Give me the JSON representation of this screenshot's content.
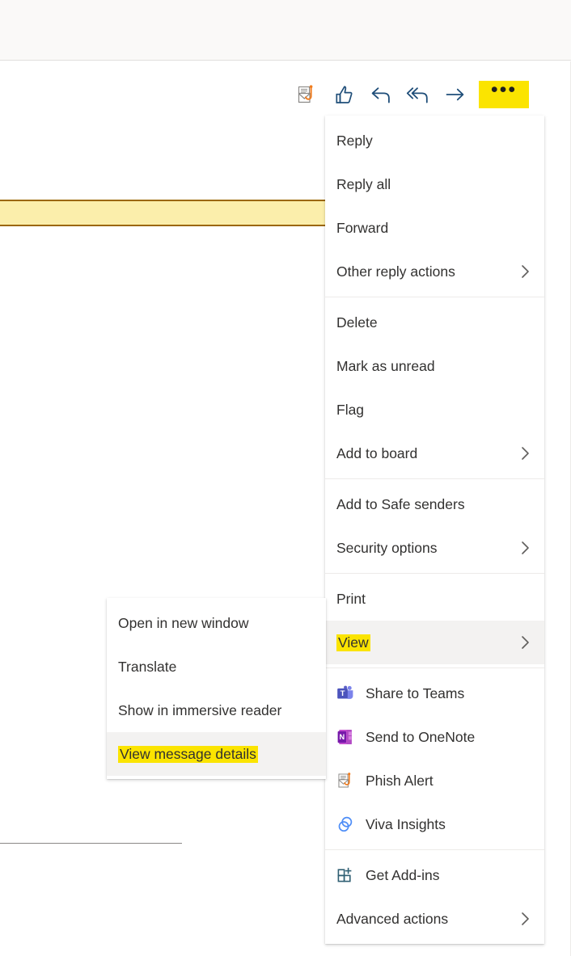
{
  "app": {
    "accent_yellow": "#fbe400",
    "hover_bg": "#f3f2f1",
    "text_color": "#323130",
    "banner_fill": "#fbeeab",
    "banner_border": "#9b6700"
  },
  "toolbar": {
    "buttons": [
      {
        "name": "phish-alert-icon",
        "label": "Phish Alert"
      },
      {
        "name": "thumbs-up-icon",
        "label": "Like"
      },
      {
        "name": "reply-icon",
        "label": "Reply"
      },
      {
        "name": "reply-all-icon",
        "label": "Reply all"
      },
      {
        "name": "forward-arrow-icon",
        "label": "Forward"
      }
    ],
    "more_actions_label": "•••",
    "more_actions_name": "more-actions-button"
  },
  "main_menu": {
    "groups": [
      {
        "items": [
          {
            "label": "Reply",
            "submenu": false,
            "icon": null,
            "highlighted": false,
            "hovered": false
          },
          {
            "label": "Reply all",
            "submenu": false,
            "icon": null,
            "highlighted": false,
            "hovered": false
          },
          {
            "label": "Forward",
            "submenu": false,
            "icon": null,
            "highlighted": false,
            "hovered": false
          },
          {
            "label": "Other reply actions",
            "submenu": true,
            "icon": null,
            "highlighted": false,
            "hovered": false
          }
        ]
      },
      {
        "items": [
          {
            "label": "Delete",
            "submenu": false,
            "icon": null,
            "highlighted": false,
            "hovered": false
          },
          {
            "label": "Mark as unread",
            "submenu": false,
            "icon": null,
            "highlighted": false,
            "hovered": false
          },
          {
            "label": "Flag",
            "submenu": false,
            "icon": null,
            "highlighted": false,
            "hovered": false
          },
          {
            "label": "Add to board",
            "submenu": true,
            "icon": null,
            "highlighted": false,
            "hovered": false
          }
        ]
      },
      {
        "items": [
          {
            "label": "Add to Safe senders",
            "submenu": false,
            "icon": null,
            "highlighted": false,
            "hovered": false
          },
          {
            "label": "Security options",
            "submenu": true,
            "icon": null,
            "highlighted": false,
            "hovered": false
          }
        ]
      },
      {
        "items": [
          {
            "label": "Print",
            "submenu": false,
            "icon": null,
            "highlighted": false,
            "hovered": false
          },
          {
            "label": "View",
            "submenu": true,
            "icon": null,
            "highlighted": true,
            "hovered": true
          }
        ]
      },
      {
        "items": [
          {
            "label": "Share to Teams",
            "submenu": false,
            "icon": "teams-icon",
            "highlighted": false,
            "hovered": false
          },
          {
            "label": "Send to OneNote",
            "submenu": false,
            "icon": "onenote-icon",
            "highlighted": false,
            "hovered": false
          },
          {
            "label": "Phish Alert",
            "submenu": false,
            "icon": "phish-alert-icon",
            "highlighted": false,
            "hovered": false
          },
          {
            "label": "Viva Insights",
            "submenu": false,
            "icon": "viva-insights-icon",
            "highlighted": false,
            "hovered": false
          }
        ]
      },
      {
        "items": [
          {
            "label": "Get Add-ins",
            "submenu": false,
            "icon": "get-addins-icon",
            "highlighted": false,
            "hovered": false
          },
          {
            "label": "Advanced actions",
            "submenu": true,
            "icon": null,
            "highlighted": false,
            "hovered": false
          }
        ]
      }
    ]
  },
  "view_submenu": {
    "groups": [
      {
        "items": [
          {
            "label": "Open in new window",
            "submenu": false,
            "icon": null,
            "highlighted": false,
            "hovered": false
          },
          {
            "label": "Translate",
            "submenu": false,
            "icon": null,
            "highlighted": false,
            "hovered": false
          },
          {
            "label": "Show in immersive reader",
            "submenu": false,
            "icon": null,
            "highlighted": false,
            "hovered": false
          },
          {
            "label": "View message details",
            "submenu": false,
            "icon": null,
            "highlighted": true,
            "hovered": true
          }
        ]
      }
    ]
  }
}
